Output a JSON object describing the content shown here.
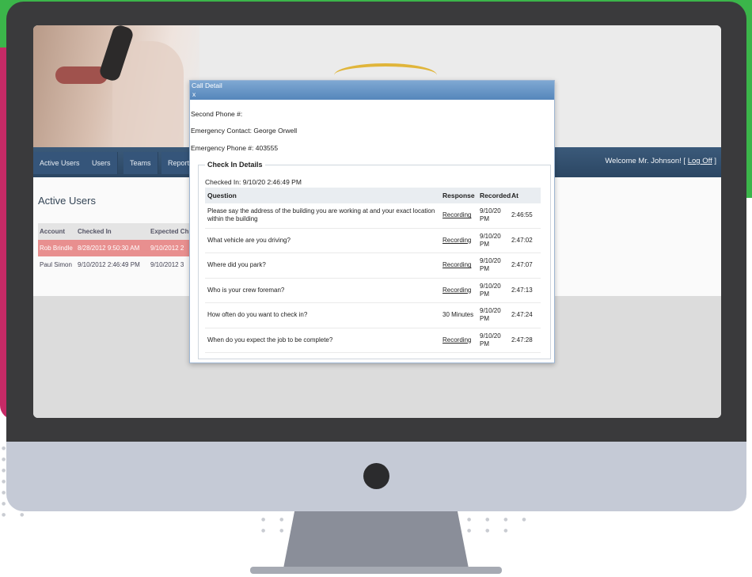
{
  "nav": {
    "tabs": [
      {
        "label": "Active Users"
      },
      {
        "label": "Users"
      },
      {
        "label": "Teams"
      },
      {
        "label": "Report"
      }
    ],
    "welcome_text": "Welcome Mr. Johnson! [",
    "logoff_label": "Log Off",
    "welcome_close": " ]"
  },
  "page": {
    "heading": "Active Users",
    "columns": [
      "Account",
      "Checked In",
      "Expected Ch"
    ],
    "rows": [
      {
        "account": "Rob Brindle",
        "checked_in": "8/28/2012 9:50:30 AM",
        "expected": "9/10/2012 2",
        "alert": true
      },
      {
        "account": "Paul Simon",
        "checked_in": "9/10/2012 2:46:49 PM",
        "expected": "9/10/2012 3",
        "alert": false
      }
    ]
  },
  "dialog": {
    "title": "Call Detail",
    "close_label": "x",
    "second_phone": "Second Phone #:",
    "emergency_contact": "Emergency Contact: George Orwell",
    "emergency_phone": "Emergency Phone #: 403555",
    "section_title": "Check In Details",
    "checked_in": "Checked In: 9/10/20    2:46:49 PM",
    "table_headers": {
      "question": "Question",
      "response": "Response",
      "recorded": "Recorded",
      "at": "At"
    },
    "rows": [
      {
        "question": "Please say the address of the building you are working at and your exact location within the building",
        "response": "Recording",
        "date": "9/10/20 PM",
        "time": "2:46:55"
      },
      {
        "question": "What vehicle are you driving?",
        "response": "Recording",
        "date": "9/10/20 PM",
        "time": "2:47:02"
      },
      {
        "question": "Where did you park?",
        "response": "Recording",
        "date": "9/10/20 PM",
        "time": "2:47:07"
      },
      {
        "question": "Who is your crew foreman?",
        "response": "Recording",
        "date": "9/10/20 PM",
        "time": "2:47:13"
      },
      {
        "question": "How often do you want to check in?",
        "response": "30 Minutes",
        "date": "9/10/20 PM",
        "time": "2:47:24"
      },
      {
        "question": "When do you expect the job to be complete?",
        "response": "Recording",
        "date": "9/10/20 PM",
        "time": "2:47:28"
      }
    ]
  },
  "colors": {
    "brand_green": "#3bb54a",
    "brand_magenta": "#c62a66",
    "navbar": "#2b4663",
    "alert_row": "#e88f8f",
    "dialog_title": "#5586bb"
  }
}
